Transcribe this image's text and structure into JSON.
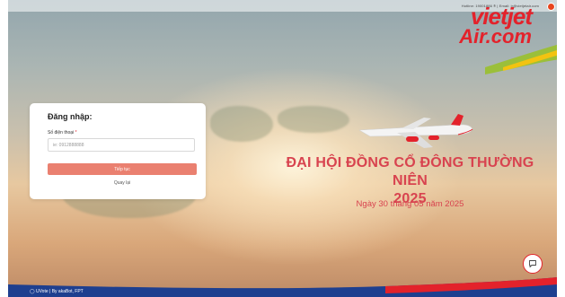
{
  "header": {
    "contact": "Hotline: 19001886 ® | Email: ir@vietjetair.com",
    "brand_line1": "vietjet",
    "brand_line2": "Air.com"
  },
  "event": {
    "title_line1": "ĐẠI HỘI ĐỒNG CỔ ĐÔNG THƯỜNG NIÊN",
    "title_line2": "2025",
    "date": "Ngày 30 tháng 05 năm 2025"
  },
  "login": {
    "title": "Đăng nhập:",
    "phone_label": "Số điện thoại",
    "required_mark": "*",
    "phone_placeholder": "ie: 0912888888",
    "phone_value": "",
    "continue_label": "Tiếp tục",
    "back_label": "Quay lại"
  },
  "footer": {
    "text": "UVote | By akaBot, FPT"
  },
  "icons": {
    "support": "chat-bubble-icon",
    "user": "user-badge-icon",
    "footer_logo": "uvote-logo-icon"
  },
  "colors": {
    "brand_red": "#e3222b",
    "title_red": "#d8434f",
    "button": "#ea8070",
    "brand_yellow": "#f2c311"
  }
}
